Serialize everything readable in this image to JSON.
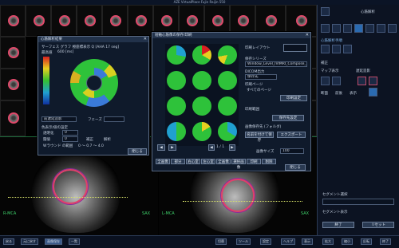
{
  "app": {
    "title": "AZE VirtualPlace Fujin Raijin 550"
  },
  "bullseye_dialog": {
    "title": "心筋解析結果",
    "close": "✕",
    "view_label": "サーフェス グラフ 極座標表示 Q [AHA 17 seg]",
    "scale_top": "最高値",
    "scale_value": "600 [ms]",
    "dropdown": "前遅延造影",
    "phase_label": "フェーズ",
    "group_label": "色表示/値の設定",
    "opt1": "透明化",
    "opt1_value": "0",
    "opt2": "閾値",
    "opt2_value": "0",
    "check1": "補正",
    "check2": "解析",
    "range_label": "Wラウンド の範囲",
    "range_value": "0 ～ 0.7 ～ 4.0",
    "close_button": "閉じる"
  },
  "thumb_dialog": {
    "title": "短軸心筋像の保存/印刷",
    "close": "✕",
    "layout_label": "印刷レイアウト",
    "series_label": "保存シリーズ",
    "series_value": "Window_Level_IVIMRI_Compose_IWM",
    "dicom_label": "DICOM出力",
    "dicom_value": "保存先",
    "print_label": "印刷ページ",
    "print_value": "すべてのページ",
    "print_button": "印刷設定",
    "page_label": "印刷範囲",
    "save_label": "画像保存先 (フォルダ)",
    "save_dir_button": "保存先設定",
    "name_button": "名前を付けて保存",
    "export_button": "エクスポート",
    "size_label": "画像サイズ",
    "size_value": "100",
    "nav_prev": "◀",
    "nav_next": "▶",
    "page_prev": "◀",
    "page_next": "▶",
    "page_count": "1 / 1",
    "tabs": [
      "全画像",
      "部分",
      "右心室",
      "左心室",
      "全画像",
      "選択画像",
      "印刷",
      "削除"
    ],
    "close_button": "閉じる",
    "apply_button": "適用"
  },
  "right_panel": {
    "top_label": "心筋解析",
    "section1": "心筋解析手順",
    "section2": "補正",
    "section3": "マップ表示",
    "section4": "遅延造影",
    "label_a": "断面",
    "label_b": "前後",
    "label_c": "表示",
    "bottom_title": "セグメント選択",
    "bottom_label": "セグメント表示",
    "button_end": "終了",
    "button_reset": "リセット"
  },
  "viewer": {
    "left_label": "R-MCA",
    "right_label": "L-MCA",
    "tag_left": "SAX",
    "tag_right": "SAX"
  },
  "bottom_bar": {
    "items": [
      "戻る",
      "元に戻す",
      "画像保存",
      "一覧",
      "切替",
      "ツール",
      "設定",
      "ヘルプ",
      "表示",
      "拡大",
      "縮小",
      "反転",
      "終了"
    ]
  },
  "colors": {
    "accent": "#4a86c8",
    "green_overlay": "#3ecf6a",
    "contour": "#e0416a"
  }
}
